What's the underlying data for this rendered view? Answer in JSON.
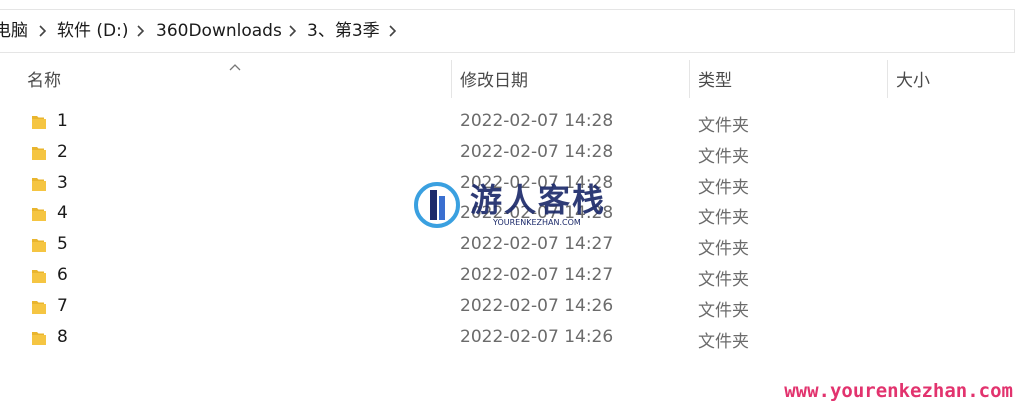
{
  "breadcrumb": {
    "items": [
      "电脑",
      "软件 (D:)",
      "360Downloads",
      "3、第3季"
    ]
  },
  "columns": {
    "name": "名称",
    "date": "修改日期",
    "type": "类型",
    "size": "大小"
  },
  "rows": [
    {
      "name": "1",
      "date": "2022-02-07 14:28",
      "type": "文件夹"
    },
    {
      "name": "2",
      "date": "2022-02-07 14:28",
      "type": "文件夹"
    },
    {
      "name": "3",
      "date": "2022-02-07 14:28",
      "type": "文件夹"
    },
    {
      "name": "4",
      "date": "2022-02-07 14:28",
      "type": "文件夹"
    },
    {
      "name": "5",
      "date": "2022-02-07 14:27",
      "type": "文件夹"
    },
    {
      "name": "6",
      "date": "2022-02-07 14:27",
      "type": "文件夹"
    },
    {
      "name": "7",
      "date": "2022-02-07 14:26",
      "type": "文件夹"
    },
    {
      "name": "8",
      "date": "2022-02-07 14:26",
      "type": "文件夹"
    }
  ],
  "watermark": {
    "title": "游人客栈",
    "subtitle": "YOURENKEZHAN.COM",
    "url": "www.yourenkezhan.com"
  },
  "colors": {
    "folder": "#f5c542",
    "watermark_text": "#1d2b6b",
    "watermark_url": "#e2336e"
  }
}
